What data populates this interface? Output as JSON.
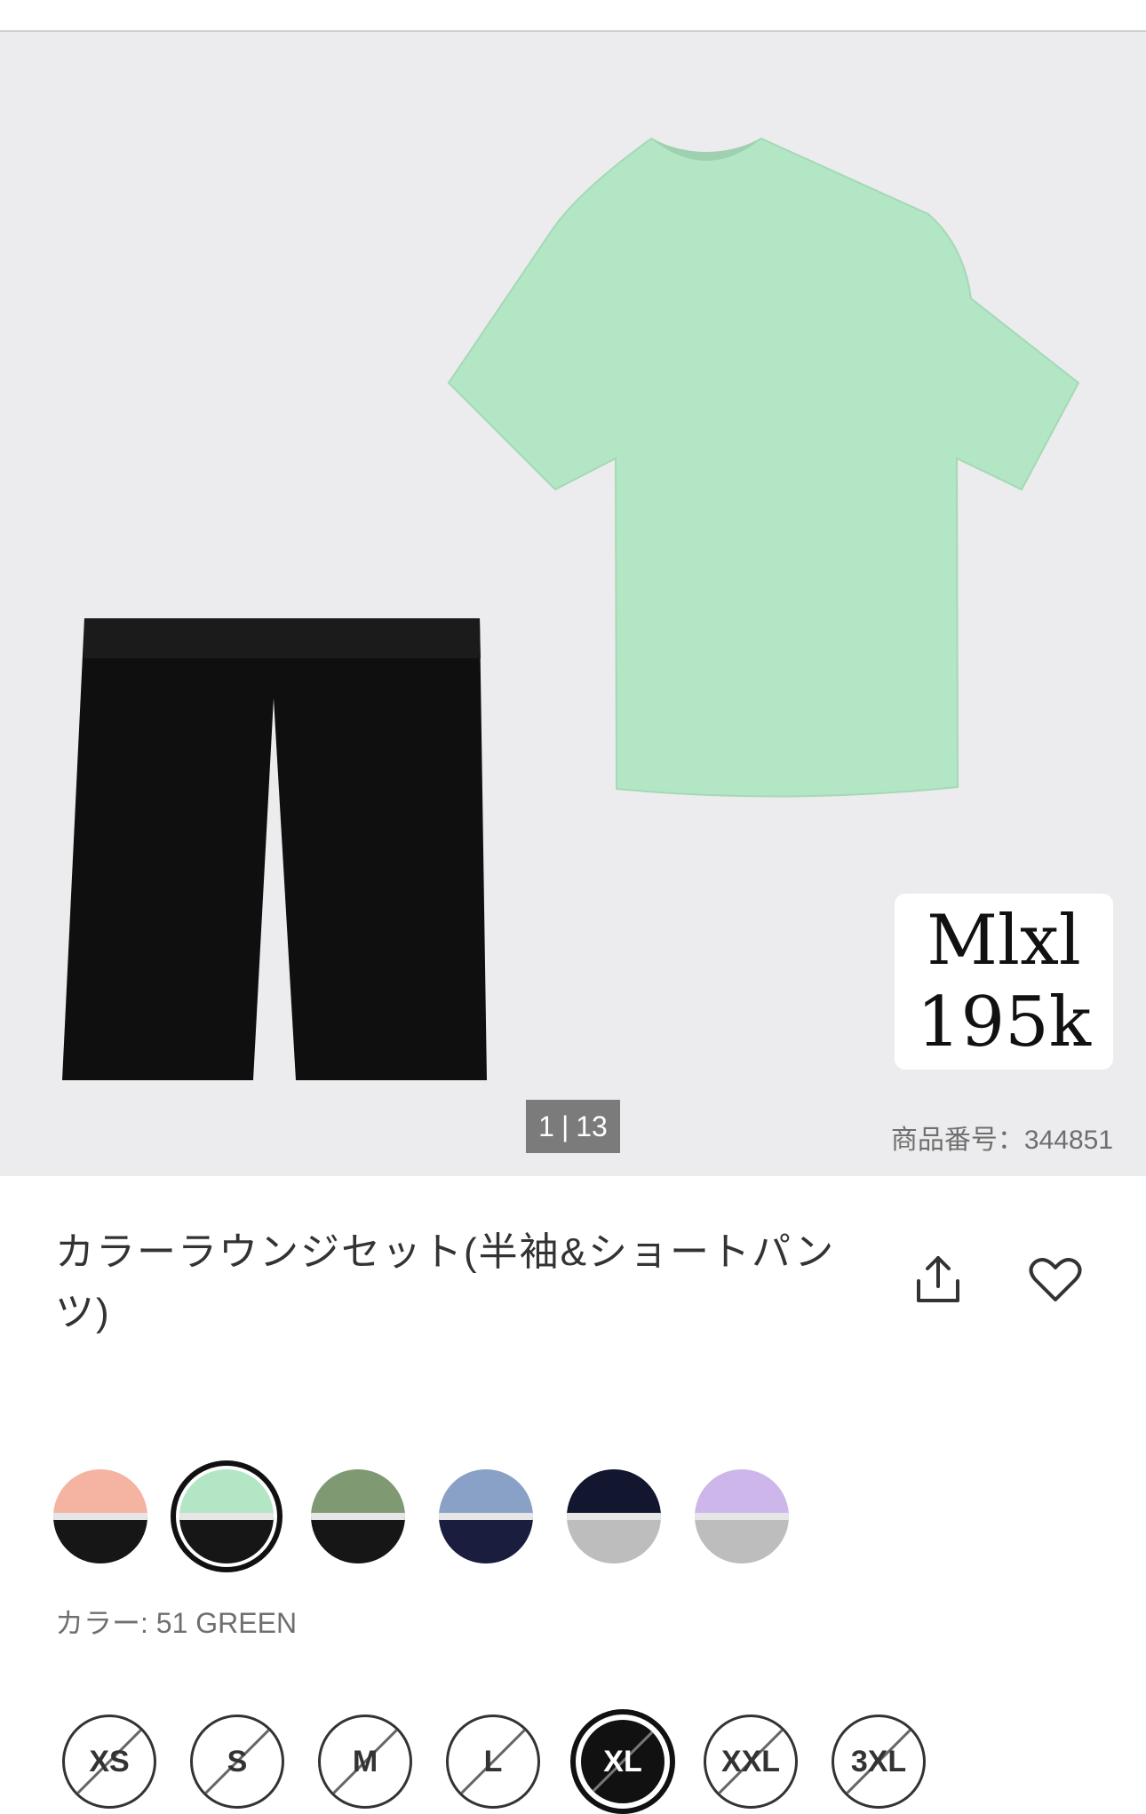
{
  "hero": {
    "price_badge": {
      "line1": "Mlxl",
      "line2": "195k"
    },
    "image_counter": {
      "current": "1",
      "total": "13"
    },
    "product_number": "商品番号：344851"
  },
  "product": {
    "title": "カラーラウンジセット(半袖&ショートパンツ)",
    "actions": {
      "share": "share-icon",
      "favorite": "heart-icon"
    }
  },
  "colors": {
    "label": "カラー: 51 GREEN",
    "swatches": [
      {
        "top": "#f5b4a2",
        "bottom": "#161616"
      },
      {
        "top": "#b3e6c4",
        "bottom": "#161616",
        "selected": true
      },
      {
        "top": "#7f9a72",
        "bottom": "#161616"
      },
      {
        "top": "#89a1c6",
        "bottom": "#1a1d3e"
      },
      {
        "top": "#12162e",
        "bottom": "#bdbdbd"
      },
      {
        "top": "#cdb7ea",
        "bottom": "#bdbdbd"
      }
    ]
  },
  "sizes": {
    "options": [
      {
        "label": "XS",
        "available": false
      },
      {
        "label": "S",
        "available": false
      },
      {
        "label": "M",
        "available": false
      },
      {
        "label": "L",
        "available": false
      },
      {
        "label": "XL",
        "available": false,
        "selected": true
      },
      {
        "label": "XXL",
        "available": false
      },
      {
        "label": "3XL",
        "available": false
      }
    ]
  },
  "style": {
    "shirt_color": "#b3e6c4",
    "shorts_color": "#0f0f0f",
    "hero_bg": "#ececee"
  }
}
